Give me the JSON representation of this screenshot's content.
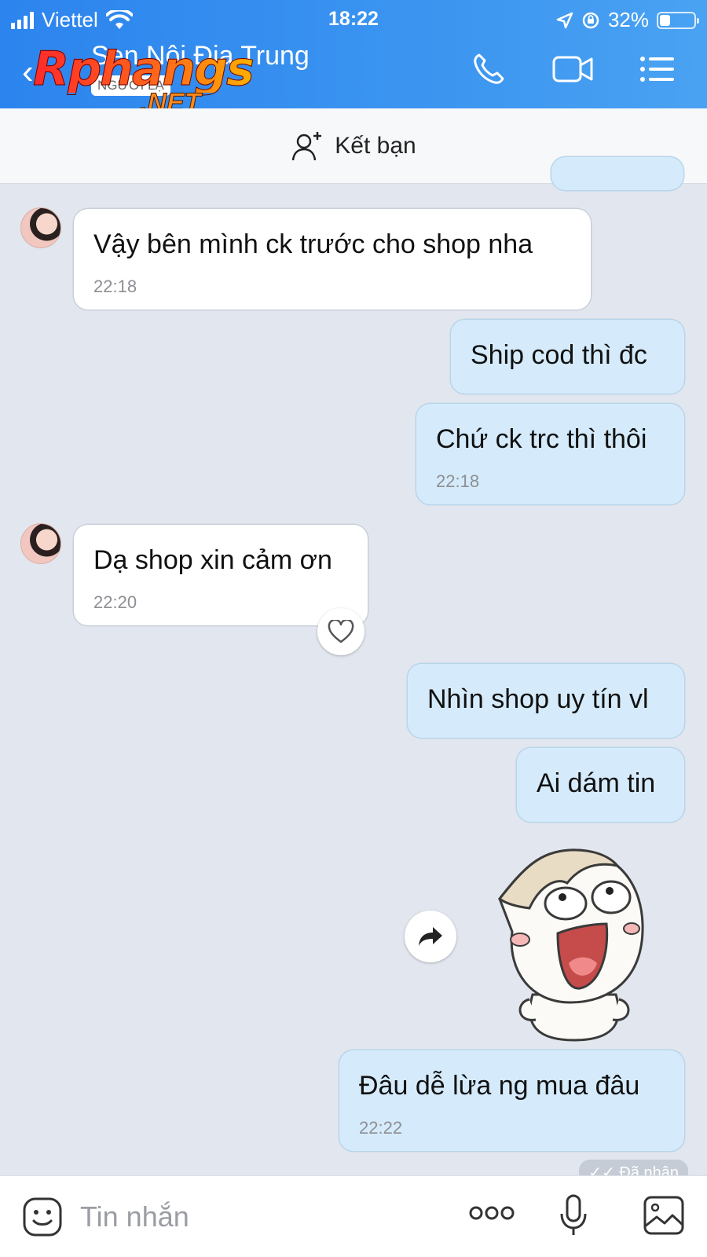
{
  "status_bar": {
    "carrier": "Viettel",
    "time": "18:22",
    "battery": "32%",
    "battery_level": 0.32
  },
  "header": {
    "contact_name": "Sen Nội Địa Trung",
    "stranger_badge": "NGƯỜI LẠ",
    "watermark_top": "Rphangs",
    "watermark_bottom": ".NET"
  },
  "friend_bar": {
    "label": "Kết bạn"
  },
  "messages": [
    {
      "text": "Vậy bên mình ck trước cho shop nha",
      "time": "22:18"
    },
    {
      "text": "Ship cod thì đc"
    },
    {
      "text": "Chứ ck trc thì thôi",
      "time": "22:18"
    },
    {
      "text": "Dạ shop xin cảm ơn",
      "time": "22:20"
    },
    {
      "text": "Nhìn shop uy tín vl"
    },
    {
      "text": "Ai dám tin"
    },
    {
      "text": "Đâu dễ lừa ng mua đâu",
      "time": "22:22"
    }
  ],
  "status_received": "Đã nhận",
  "composer": {
    "placeholder": "Tin nhắn"
  },
  "colors": {
    "header": "#2c84ee",
    "outgoing_bubble": "#d5ebfb",
    "incoming_bubble": "#ffffff",
    "chat_bg": "#e2e6ee"
  },
  "icons": [
    "back-icon",
    "phone-icon",
    "video-call-icon",
    "menu-list-icon",
    "add-friend-icon",
    "heart-icon",
    "forward-icon",
    "sticker-icon",
    "more-icon",
    "microphone-icon",
    "image-icon"
  ]
}
